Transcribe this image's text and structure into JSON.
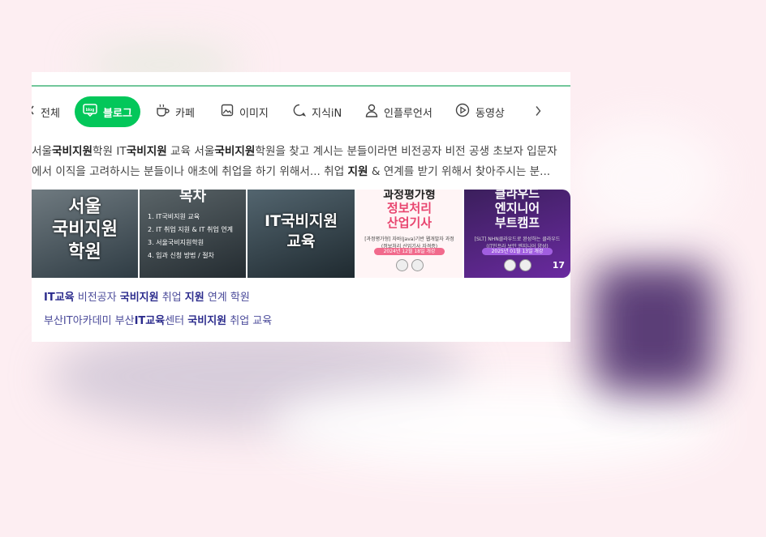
{
  "tabs": {
    "all": "전체",
    "blog": "블로그",
    "blog_icon_text": "blog",
    "cafe": "카페",
    "image": "이미지",
    "kin": "지식iN",
    "influencer": "인플루언서",
    "video": "동영상"
  },
  "snippet": {
    "line1": [
      {
        "t": "서울",
        "b": false
      },
      {
        "t": "국비지원",
        "b": true
      },
      {
        "t": "학원 IT",
        "b": false
      },
      {
        "t": "국비지원",
        "b": true
      },
      {
        "t": " 교육 서울",
        "b": false
      },
      {
        "t": "국비지원",
        "b": true
      },
      {
        "t": "학원을 찾고 계시는 분들이라면 비전공자 비전 공생 초보자 입문자",
        "b": false
      }
    ],
    "line2": [
      {
        "t": "에서 이직을 고려하시는 분들이나 애초에 취업을 하기 위해서... 취업 ",
        "b": false
      },
      {
        "t": "지원",
        "b": true
      },
      {
        "t": " & 연계를 받기 위해서 찾아주시는 분...",
        "b": false
      }
    ]
  },
  "thumbnails": {
    "t1": "서울\n국비지원\n학원",
    "t2_title": "목차",
    "t2_items": [
      "1. IT국비지원 교육",
      "2. IT 취업 지원 & IT 취업 연계",
      "3. 서울국비지원학원",
      "4. 입과 신청 방법 / 절차"
    ],
    "t3": "IT국비지원\n교육",
    "t4_title": "과정평가형",
    "t4_sub": "정보처리\n산업기사",
    "t4_small": "[과정평가형] 자바(Java)기반 웹개발자 과정\n(정보처리 산업기사 자격증)",
    "t4_date": "2024년 12월 18일 개강",
    "t5_title": "클라우드\n엔지니어\n부트캠프",
    "t5_small": "[SLT] NHN클라우드로 완성하는 클라우드\n(IT인프라 보안 엔지니어 양성)",
    "t5_date": "2025년 01월 13일 개강",
    "count": "17"
  },
  "related": {
    "line1": [
      {
        "t": "IT교육",
        "b": true
      },
      {
        "t": " 비전공자 ",
        "b": false
      },
      {
        "t": "국비지원",
        "b": true
      },
      {
        "t": " 취업 ",
        "b": false
      },
      {
        "t": "지원",
        "b": true
      },
      {
        "t": " 연계 학원",
        "b": false
      }
    ],
    "line2": [
      {
        "t": "부산IT아카데미 부산",
        "b": false
      },
      {
        "t": "IT교육",
        "b": true
      },
      {
        "t": "센터 ",
        "b": false
      },
      {
        "t": "국비지원",
        "b": true
      },
      {
        "t": " 취업 교육",
        "b": false
      }
    ]
  },
  "colors": {
    "accent": "#03c75a",
    "link": "#2b2b8c",
    "background": "#fdeef2"
  },
  "icons": [
    "chevron-left-icon",
    "blog-icon",
    "coffee-icon",
    "image-icon",
    "chat-bubble-icon",
    "person-icon",
    "play-circle-icon",
    "chevron-right-icon"
  ]
}
